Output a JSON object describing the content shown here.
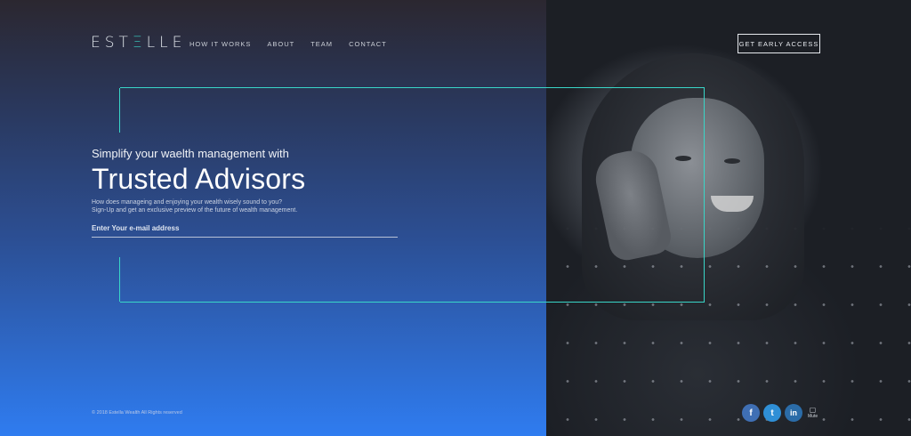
{
  "brand": {
    "logo_pre": "EST",
    "logo_accent": "Ξ",
    "logo_post": "LLE",
    "accent_color": "#39d6c8"
  },
  "nav": {
    "items": [
      {
        "label": "HOW IT WORKS"
      },
      {
        "label": "ABOUT"
      },
      {
        "label": "TEAM"
      },
      {
        "label": "CONTACT"
      }
    ]
  },
  "header": {
    "cta_label": "GET EARLY ACCESS"
  },
  "hero": {
    "subtitle": "Simplify your waelth management with",
    "title": "Trusted Advisors",
    "desc_line1": "How does manageing and enjoying your wealth wisely sound to you?",
    "desc_line2": "Sign-Up and get an exclusive preview of the future of wealth management."
  },
  "form": {
    "email_placeholder": "Enter Your e-mail address"
  },
  "footer": {
    "copyright": "© 2018 Estella Wealth All Rights reserved",
    "social": [
      {
        "icon": "facebook-icon",
        "glyph": "f"
      },
      {
        "icon": "twitter-icon",
        "glyph": "t"
      },
      {
        "icon": "linkedin-icon",
        "glyph": "in"
      }
    ],
    "mute_label": "Mute"
  },
  "colors": {
    "gradient_top": "#2b2730",
    "gradient_bottom": "#2f7cf0",
    "accent": "#39d6c8"
  }
}
